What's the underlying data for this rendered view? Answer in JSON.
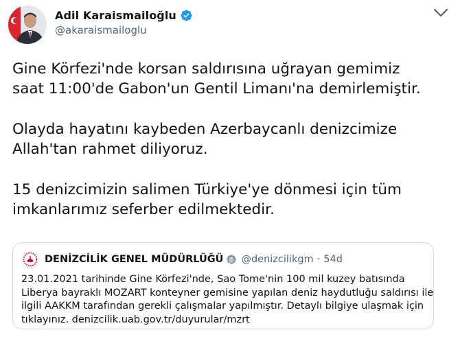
{
  "author": {
    "display_name": "Adil Karaismailoğlu",
    "handle": "@akaraismailoglu",
    "verified_color": "#1d9bf0"
  },
  "tweet": {
    "paragraphs": [
      [
        "Gine Körfezi'nde korsan saldırısına uğrayan gemimiz",
        "saat 11:00'de Gabon'un Gentil Limanı'na demirlemiştir."
      ],
      [
        "Olayda hayatını kaybeden Azerbaycanlı denizcimize",
        "Allah'tan rahmet diliyoruz."
      ],
      [
        "15 denizcimizin salimen Türkiye'ye dönmesi için tüm",
        "imkanlarımız seferber edilmektedir."
      ]
    ]
  },
  "quoted": {
    "name": "DENİZCİLİK GENEL MÜDÜRLÜĞÜ",
    "handle": "@denizcilikgm",
    "separator": "·",
    "time": "54d",
    "lines": [
      "23.01.2021 tarihinde Gine Körfezi'nde, Sao Tome'nin 100 mil kuzey batısında",
      "Liberya bayraklı MOZART konteyner gemisine yapılan deniz haydutluğu saldırısı ile",
      "ilgili AAKKM tarafından gerekli çalışmalar yapılmıştır. Detaylı bilgiye ulaşmak için",
      "tıklayınız. denizcilik.uab.gov.tr/duyurular/mzrt"
    ],
    "badge_color": "#c8102e"
  },
  "icons": {
    "more": "more-options-icon",
    "verified": "verified-badge-icon"
  }
}
